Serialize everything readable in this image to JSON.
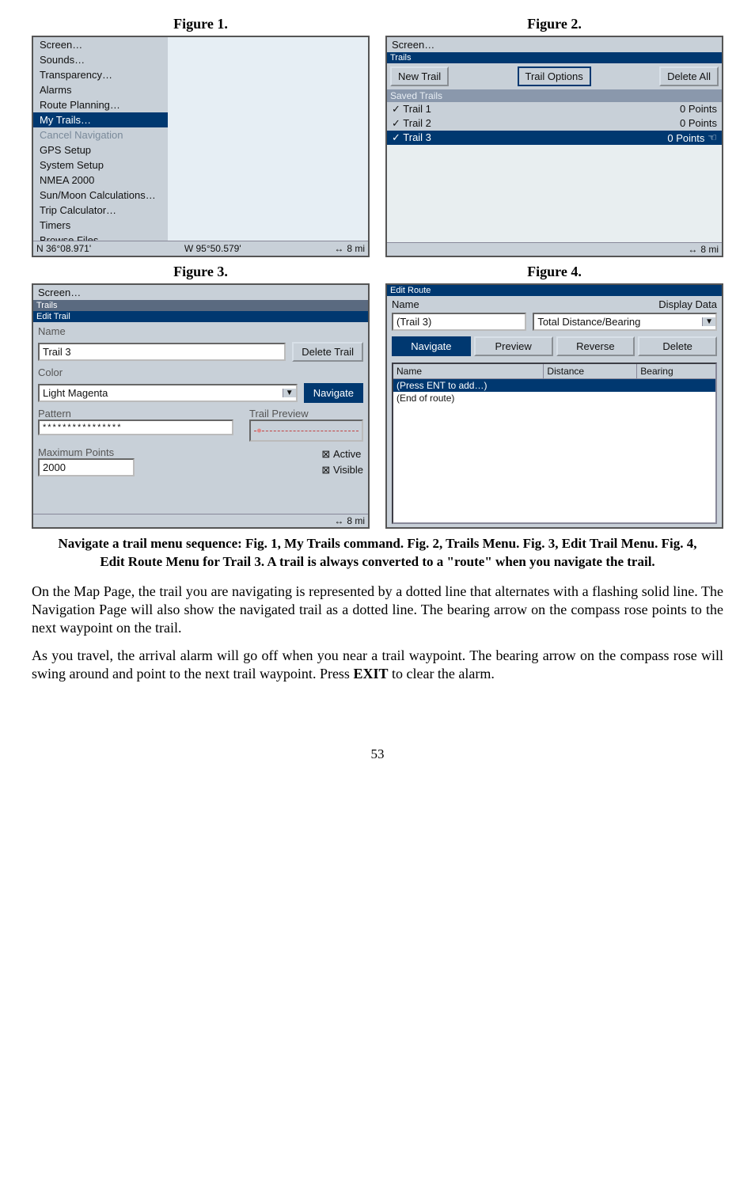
{
  "fig_titles": {
    "f1": "Figure 1.",
    "f2": "Figure 2.",
    "f3": "Figure 3.",
    "f4": "Figure 4."
  },
  "fig1": {
    "menu": [
      "Screen…",
      "Sounds…",
      "Transparency…",
      "Alarms",
      "Route Planning…",
      "My Trails…",
      "Cancel Navigation",
      "GPS Setup",
      "System Setup",
      "NMEA 2000",
      "Sun/Moon Calculations…",
      "Trip Calculator…",
      "Timers",
      "Browse Files…"
    ],
    "coord": {
      "n": "N   36°08.971'",
      "w": "W    95°50.579'",
      "dist": "8 mi"
    }
  },
  "fig2": {
    "screen": "Screen…",
    "title": "Trails",
    "buttons": {
      "new": "New Trail",
      "options": "Trail Options",
      "del": "Delete All"
    },
    "saved_hdr": "Saved Trails",
    "trails": [
      {
        "name": "Trail 1",
        "pts": "0 Points"
      },
      {
        "name": "Trail 2",
        "pts": "0 Points"
      },
      {
        "name": "Trail 3",
        "pts": "0 Points"
      }
    ],
    "dist": "8 mi"
  },
  "fig3": {
    "screen": "Screen…",
    "trails": "Trails",
    "title": "Edit Trail",
    "name_lbl": "Name",
    "name_val": "Trail 3",
    "del_trail": "Delete Trail",
    "color_lbl": "Color",
    "color_val": "Light Magenta",
    "navigate": "Navigate",
    "pattern_lbl": "Pattern",
    "pattern_val": "****************",
    "preview_lbl": "Trail Preview",
    "max_lbl": "Maximum Points",
    "max_val": "2000",
    "active": "Active",
    "visible": "Visible",
    "dist": "8 mi"
  },
  "fig4": {
    "title": "Edit Route",
    "name_lbl": "Name",
    "disp_lbl": "Display Data",
    "name_val": "(Trail 3)",
    "disp_val": "Total Distance/Bearing",
    "buttons": {
      "nav": "Navigate",
      "prev": "Preview",
      "rev": "Reverse",
      "del": "Delete"
    },
    "cols": {
      "name": "Name",
      "dist": "Distance",
      "bear": "Bearing"
    },
    "rows": {
      "r1": "(Press ENT to add…)",
      "r2": "(End of route)"
    }
  },
  "caption": "Navigate a trail menu sequence: Fig. 1, My Trails command. Fig. 2, Trails Menu. Fig. 3, Edit Trail Menu. Fig. 4, Edit Route Menu for Trail 3. A trail is always converted to a \"route\" when you navigate the trail.",
  "para1": "On the Map Page, the trail you are navigating is represented by a dotted line that alternates with a flashing solid line. The Navigation Page will also show the navigated trail as a dotted line. The bearing arrow on the compass rose points to the next waypoint on the trail.",
  "para2_a": "As you travel, the arrival alarm will go off when you near a trail waypoint. The bearing arrow on the compass rose will swing around and point to the next trail waypoint. Press ",
  "para2_b": "EXIT",
  "para2_c": " to clear the alarm.",
  "page": "53"
}
